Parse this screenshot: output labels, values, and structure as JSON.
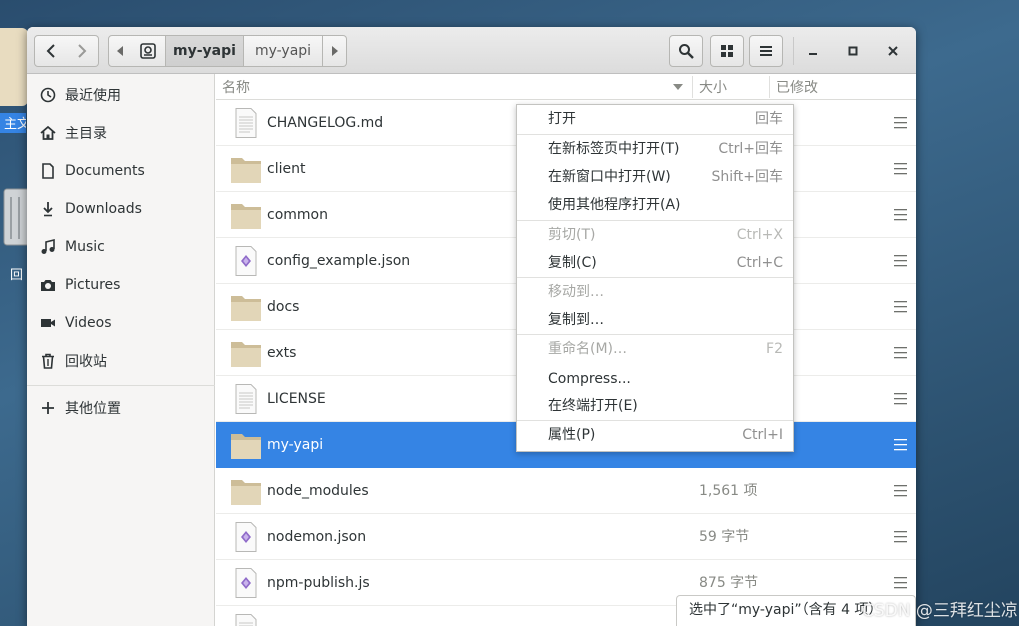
{
  "desktop": {
    "home_label": "主文件夹",
    "trash_label": "回"
  },
  "header": {
    "breadcrumbs": [
      "my-yapi",
      "my-yapi"
    ]
  },
  "sidebar": {
    "items": [
      {
        "label": "最近使用",
        "icon": "clock-icon"
      },
      {
        "label": "主目录",
        "icon": "home-icon"
      },
      {
        "label": "Documents",
        "icon": "document-icon"
      },
      {
        "label": "Downloads",
        "icon": "download-icon"
      },
      {
        "label": "Music",
        "icon": "music-icon"
      },
      {
        "label": "Pictures",
        "icon": "camera-icon"
      },
      {
        "label": "Videos",
        "icon": "video-icon"
      },
      {
        "label": "回收站",
        "icon": "trash-icon"
      },
      {
        "label": "其他位置",
        "icon": "plus-icon"
      }
    ]
  },
  "list": {
    "columns": {
      "name": "名称",
      "size": "大小",
      "modified": "已修改"
    },
    "rows": [
      {
        "name": "CHANGELOG.md",
        "type": "text",
        "size": ""
      },
      {
        "name": "client",
        "type": "folder",
        "size": ""
      },
      {
        "name": "common",
        "type": "folder",
        "size": ""
      },
      {
        "name": "config_example.json",
        "type": "json",
        "size": ""
      },
      {
        "name": "docs",
        "type": "folder",
        "size": ""
      },
      {
        "name": "exts",
        "type": "folder",
        "size": ""
      },
      {
        "name": "LICENSE",
        "type": "text",
        "size": ""
      },
      {
        "name": "my-yapi",
        "type": "folder",
        "size": "",
        "selected": true
      },
      {
        "name": "node_modules",
        "type": "folder",
        "size": "1,561 项"
      },
      {
        "name": "nodemon.json",
        "type": "json",
        "size": "59 字节"
      },
      {
        "name": "npm-publish.js",
        "type": "json",
        "size": "875 字节"
      }
    ]
  },
  "context_menu": {
    "items": [
      {
        "label": "打开",
        "accel": "回车",
        "disabled": false
      },
      {
        "label": "在新标签页中打开(T)",
        "accel": "Ctrl+回车",
        "disabled": false
      },
      {
        "label": "在新窗口中打开(W)",
        "accel": "Shift+回车",
        "disabled": false
      },
      {
        "label": "使用其他程序打开(A)",
        "accel": "",
        "disabled": false
      },
      {
        "label": "剪切(T)",
        "accel": "Ctrl+X",
        "disabled": true
      },
      {
        "label": "复制(C)",
        "accel": "Ctrl+C",
        "disabled": false
      },
      {
        "label": "移动到…",
        "accel": "",
        "disabled": true
      },
      {
        "label": "复制到…",
        "accel": "",
        "disabled": false
      },
      {
        "label": "重命名(M)…",
        "accel": "F2",
        "disabled": true
      },
      {
        "label": "Compress...",
        "accel": "",
        "disabled": false
      },
      {
        "label": "在终端打开(E)",
        "accel": "",
        "disabled": false
      },
      {
        "label": "属性(P)",
        "accel": "Ctrl+I",
        "disabled": false
      }
    ]
  },
  "status": {
    "text": "选中了“my-yapi”（含有 4 项）"
  },
  "watermark": "CSDN @三拜红尘凉",
  "colors": {
    "selection": "#3584e4",
    "folder": "#d8c9a3",
    "sidebar_bg": "#f6f5f4"
  }
}
